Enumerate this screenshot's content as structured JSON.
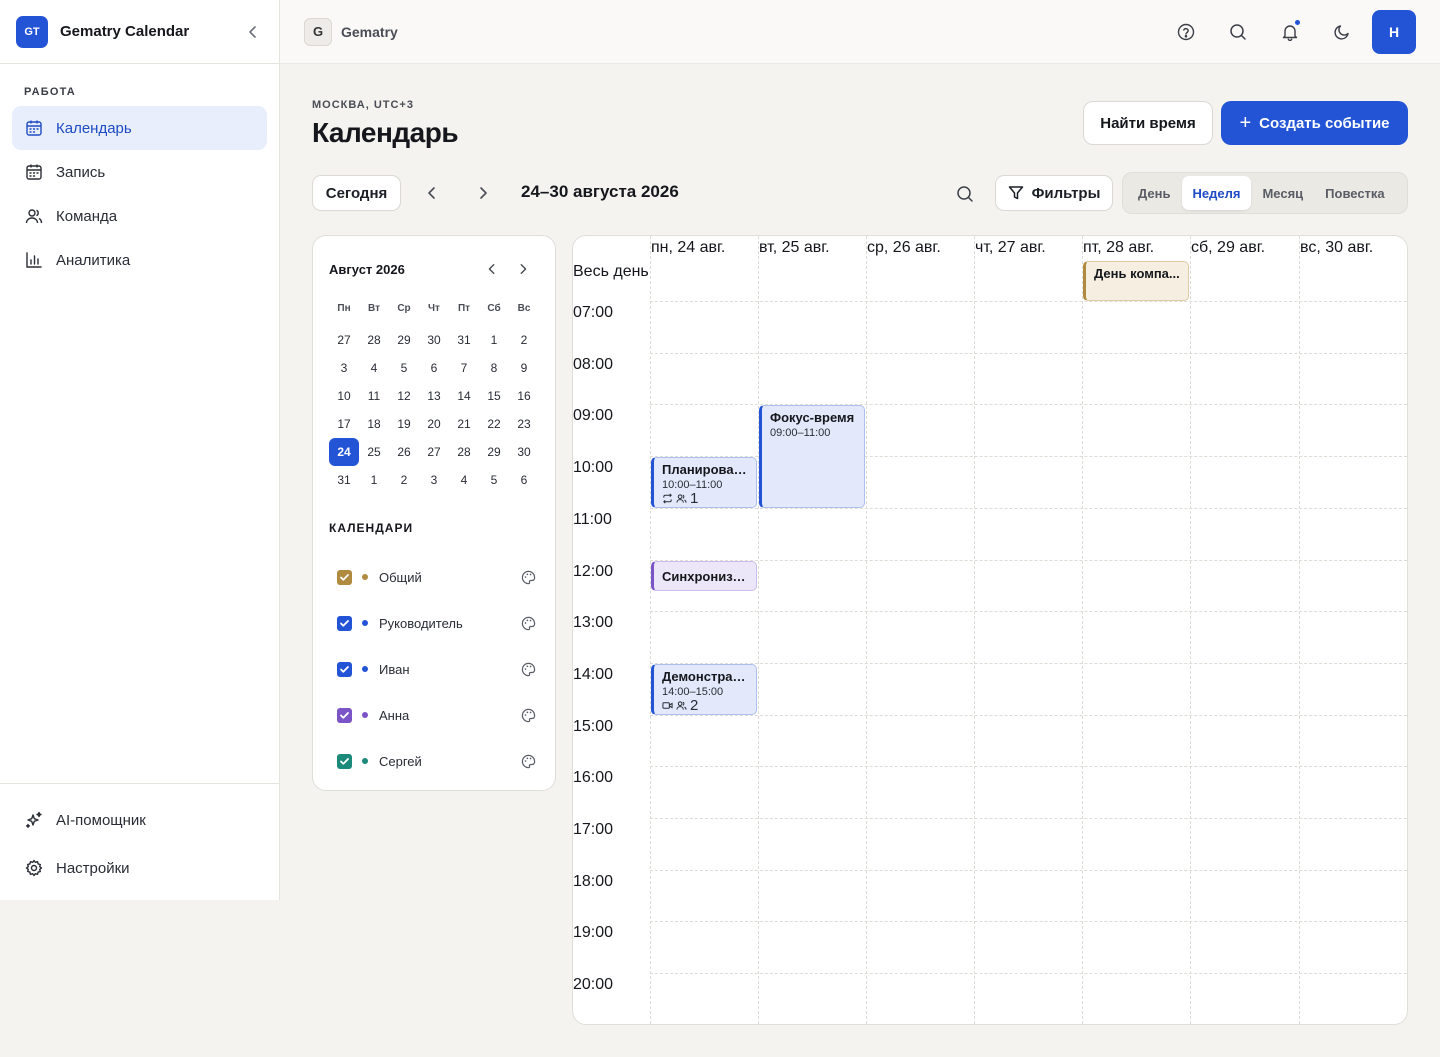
{
  "app": {
    "logo": "GT",
    "name": "Gematry Calendar"
  },
  "sidebar": {
    "section": "РАБОТА",
    "items": [
      {
        "label": "Календарь",
        "icon": "calendar-icon",
        "active": true
      },
      {
        "label": "Запись",
        "icon": "booking-icon"
      },
      {
        "label": "Команда",
        "icon": "team-icon"
      },
      {
        "label": "Аналитика",
        "icon": "analytics-icon"
      }
    ],
    "footer": [
      {
        "label": "AI-помощник",
        "icon": "sparkles-icon"
      },
      {
        "label": "Настройки",
        "icon": "settings-icon"
      }
    ]
  },
  "topbar": {
    "workspace_badge": "G",
    "workspace_name": "Gematry",
    "avatar": "Н"
  },
  "header": {
    "location": "МОСКВА, UTC+3",
    "title": "Календарь",
    "find_time": "Найти время",
    "create_event": "Создать событие"
  },
  "toolbar": {
    "today": "Сегодня",
    "range": "24–30 августа 2026",
    "filters": "Фильтры",
    "views": [
      "День",
      "Неделя",
      "Месяц",
      "Повестка"
    ],
    "active_view": "Неделя"
  },
  "minical": {
    "title": "Август 2026",
    "dow": [
      "Пн",
      "Вт",
      "Ср",
      "Чт",
      "Пт",
      "Сб",
      "Вс"
    ],
    "weeks": [
      [
        "27",
        "28",
        "29",
        "30",
        "31",
        "1",
        "2"
      ],
      [
        "3",
        "4",
        "5",
        "6",
        "7",
        "8",
        "9"
      ],
      [
        "10",
        "11",
        "12",
        "13",
        "14",
        "15",
        "16"
      ],
      [
        "17",
        "18",
        "19",
        "20",
        "21",
        "22",
        "23"
      ],
      [
        "24",
        "25",
        "26",
        "27",
        "28",
        "29",
        "30"
      ],
      [
        "31",
        "1",
        "2",
        "3",
        "4",
        "5",
        "6"
      ]
    ],
    "selected": "24"
  },
  "calendars": {
    "heading": "КАЛЕНДАРИ",
    "items": [
      {
        "name": "Общий",
        "color": "#b08a3e",
        "checked": true
      },
      {
        "name": "Руководитель",
        "color": "#2454d6",
        "checked": true
      },
      {
        "name": "Иван",
        "color": "#2454d6",
        "checked": true
      },
      {
        "name": "Анна",
        "color": "#7b55c8",
        "checked": true
      },
      {
        "name": "Сергей",
        "color": "#1b8a7a",
        "checked": true
      }
    ]
  },
  "week": {
    "days": [
      "пн, 24 авг.",
      "вт, 25 авг.",
      "ср, 26 авг.",
      "чт, 27 авг.",
      "пт, 28 авг.",
      "сб, 29 авг.",
      "вс, 30 авг."
    ],
    "allday_label": "Весь день",
    "hours": [
      "07:00",
      "08:00",
      "09:00",
      "10:00",
      "11:00",
      "12:00",
      "13:00",
      "14:00",
      "15:00",
      "16:00",
      "17:00",
      "18:00",
      "19:00",
      "20:00"
    ],
    "allday_events": [
      {
        "day": 4,
        "title": "День компа...",
        "color": "#b08a3e",
        "bg": "#f6efe1"
      }
    ],
    "events": [
      {
        "day": 1,
        "start": 9,
        "end": 11,
        "title": "Фокус-время",
        "time": "09:00–11:00",
        "color": "#2454d6",
        "bg": "#e3e9fb"
      },
      {
        "day": 0,
        "start": 10,
        "end": 11,
        "title": "Планирован...",
        "time": "10:00–11:00",
        "meta_icon": "repeat-icon",
        "attendees": "1",
        "color": "#2454d6",
        "bg": "#e3e9fb"
      },
      {
        "day": 0,
        "start": 12,
        "end": 12.6,
        "title": "Синхрониза...",
        "color": "#7b55c8",
        "bg": "#ece7f8"
      },
      {
        "day": 0,
        "start": 14,
        "end": 15,
        "title": "Демонстрац...",
        "time": "14:00–15:00",
        "meta_icon": "video-icon",
        "attendees": "2",
        "color": "#2454d6",
        "bg": "#e3e9fb"
      }
    ]
  }
}
